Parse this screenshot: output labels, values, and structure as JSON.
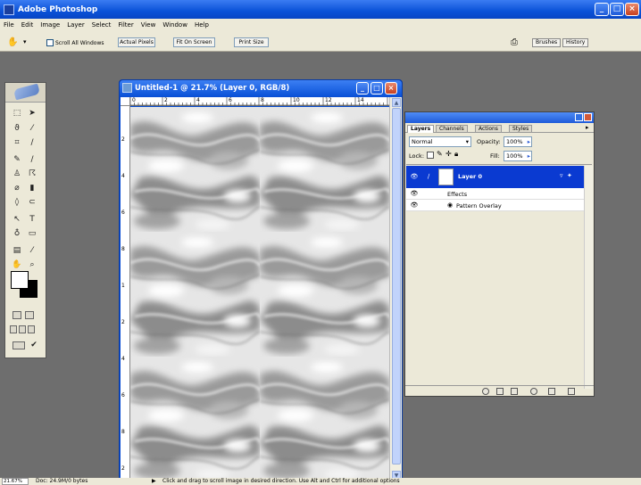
{
  "app": {
    "title": "Adobe Photoshop",
    "window_buttons": [
      "_",
      "□",
      "×"
    ]
  },
  "menu": [
    "File",
    "Edit",
    "Image",
    "Layer",
    "Select",
    "Filter",
    "View",
    "Window",
    "Help"
  ],
  "options_bar": {
    "scroll_all_label": "Scroll All Windows",
    "actual_pixels": "Actual Pixels",
    "fit_on_screen": "Fit On Screen",
    "print_size": "Print Size",
    "well_tabs": [
      "Brushes",
      "History"
    ]
  },
  "document": {
    "title": "Untitled-1 @ 21.7% (Layer 0, RGB/8)",
    "ruler_top_numbers": [
      "0",
      "2",
      "4",
      "6",
      "8",
      "10",
      "12",
      "14"
    ],
    "ruler_left_numbers": [
      "2",
      "4",
      "6",
      "8",
      "1",
      "2",
      "4",
      "6",
      "8",
      "2"
    ]
  },
  "layers_palette": {
    "tabs": [
      "Layers",
      "Channels",
      "Actions",
      "Styles"
    ],
    "blend_mode": "Normal",
    "opacity_label": "Opacity:",
    "opacity_value": "100%",
    "lock_label": "Lock:",
    "fill_label": "Fill:",
    "fill_value": "100%",
    "layer_name": "Layer 0",
    "effects_label": "Effects",
    "effect_name": "Pattern Overlay"
  },
  "status_bar": {
    "zoom": "21.67%",
    "doc_info": "Doc: 24.9M/0 bytes",
    "hint": "Click and drag to scroll image in desired direction.  Use Alt and Ctrl for additional options"
  },
  "colors": {
    "xp_blue": "#0a52d8",
    "chrome": "#ece9d8",
    "workspace": "#6e6e6e",
    "selected_layer": "#0a3ad1"
  }
}
